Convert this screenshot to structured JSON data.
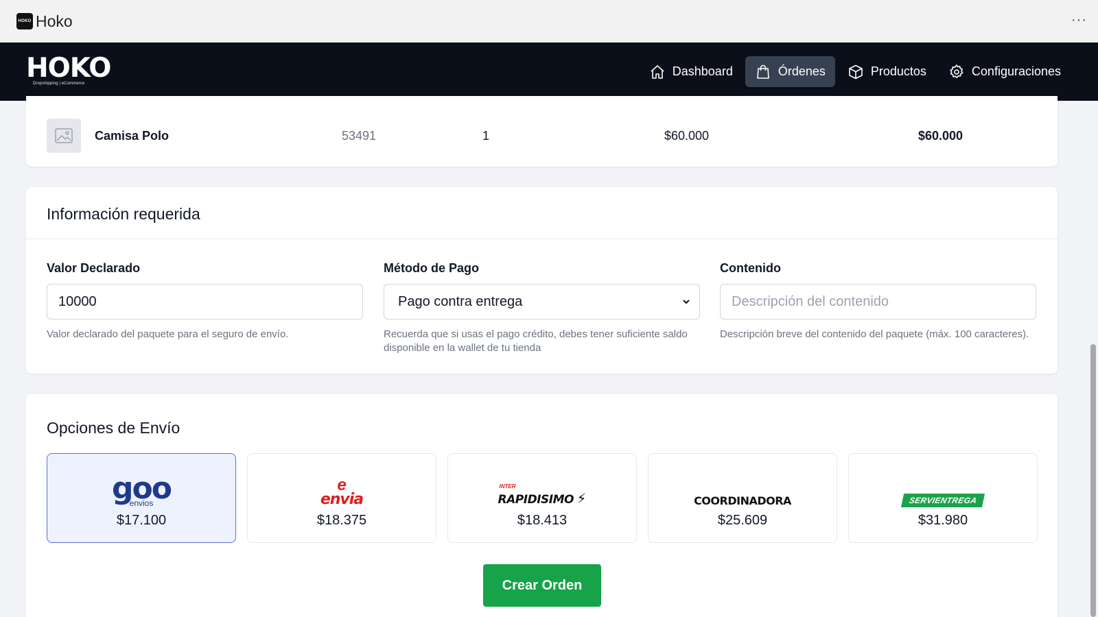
{
  "window": {
    "title": "Hoko",
    "icon_text": "HOKO",
    "more_label": "···"
  },
  "navbar": {
    "logo_text": "HOKO",
    "logo_subtitle": "Dropshipping | eCommerce",
    "items": [
      {
        "label": "Dashboard",
        "icon": "home-icon",
        "active": false
      },
      {
        "label": "Órdenes",
        "icon": "shopping-bag-icon",
        "active": true
      },
      {
        "label": "Productos",
        "icon": "box-icon",
        "active": false
      },
      {
        "label": "Configuraciones",
        "icon": "gear-icon",
        "active": false
      }
    ]
  },
  "product_row": {
    "name": "Camisa Polo",
    "sku": "53491",
    "quantity": "1",
    "unit_price": "$60.000",
    "total": "$60.000",
    "thumb_icon": "image-placeholder-icon"
  },
  "required_info": {
    "title": "Información requerida",
    "declared_value": {
      "label": "Valor Declarado",
      "value": "10000",
      "help": "Valor declarado del paquete para el seguro de envío."
    },
    "payment_method": {
      "label": "Método de Pago",
      "selected": "Pago contra entrega",
      "help": "Recuerda que si usas el pago crédito, debes tener suficiente saldo disponible en la wallet de tu tienda"
    },
    "content": {
      "label": "Contenido",
      "placeholder": "Descripción del contenido",
      "help": "Descripción breve del contenido del paquete (máx. 100 caracteres)."
    }
  },
  "shipping": {
    "title": "Opciones de Envío",
    "carriers": [
      {
        "logo_text": "goo",
        "logo_sub": "envios",
        "price": "$17.100",
        "selected": true,
        "color": "#1f3a8a"
      },
      {
        "logo_text": "envia",
        "logo_sub": "",
        "price": "$18.375",
        "selected": false,
        "color": "#e11d1d"
      },
      {
        "logo_text": "RAPIDISIMO",
        "logo_sub": "INTER",
        "price": "$18.413",
        "selected": false,
        "color": "#111111"
      },
      {
        "logo_text": "COORDINADORA",
        "logo_sub": "",
        "price": "$25.609",
        "selected": false,
        "color": "#111111"
      },
      {
        "logo_text": "SERVIENTREGA",
        "logo_sub": "",
        "price": "$31.980",
        "selected": false,
        "color": "#1aa34a"
      }
    ],
    "create_button": "Crear Orden"
  },
  "colors": {
    "navbar_bg": "#0b0f19",
    "active_nav": "#374151",
    "primary_green": "#16a34a",
    "selected_card_bg": "#eef2ff"
  }
}
